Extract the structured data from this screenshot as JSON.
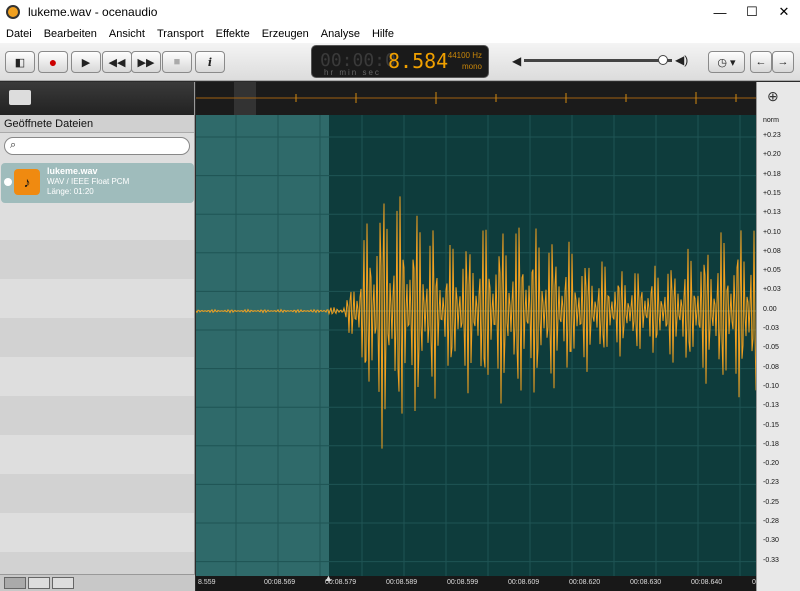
{
  "window": {
    "title": "lukeme.wav - ocenaudio"
  },
  "menu": [
    "Datei",
    "Bearbeiten",
    "Ansicht",
    "Transport",
    "Effekte",
    "Erzeugen",
    "Analyse",
    "Hilfe"
  ],
  "lcd": {
    "time": "8.584",
    "ghost": "00:00:0",
    "units": "hr  min sec",
    "rate": "44100 Hz",
    "channels": "mono"
  },
  "sidebar": {
    "heading": "Geöffnete Dateien",
    "file": {
      "name": "lukeme.wav",
      "format": "WAV / IEEE Float PCM",
      "length": "Länge: 01:20"
    }
  },
  "time_labels": [
    "8.559",
    "00:08.569",
    "00:08.579",
    "00:08.589",
    "00:08.599",
    "00:08.609",
    "00:08.620",
    "00:08.630",
    "00:08.640",
    "00:08.6"
  ],
  "amp_labels": [
    "norm",
    "+0.23",
    "+0.20",
    "+0.18",
    "+0.15",
    "+0.13",
    "+0.10",
    "+0.08",
    "+0.05",
    "+0.03",
    "0.00",
    "-0.03",
    "-0.05",
    "-0.08",
    "-0.10",
    "-0.13",
    "-0.15",
    "-0.18",
    "-0.20",
    "-0.23",
    "-0.25",
    "-0.28",
    "-0.30",
    "-0.33"
  ],
  "colors": {
    "waveform": "#f0a020",
    "selection": "#2f6a6a",
    "background": "#0e3c3c"
  }
}
